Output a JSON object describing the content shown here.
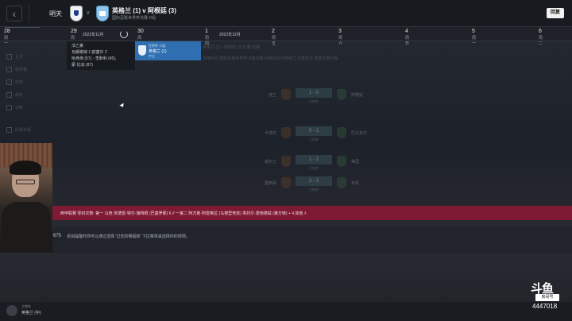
{
  "header": {
    "tomorrow_label": "明天",
    "vs_label": "v",
    "match_title": "英格兰 (1) v 阿根廷 (3)",
    "match_subtitle": "国际足联世界杯决赛 D组",
    "continue_label": "回复"
  },
  "calendar": {
    "month_nov": "2022年11月",
    "month_dec": "2022年12月",
    "days": [
      {
        "num": "28",
        "weekday": "周一"
      },
      {
        "num": "29",
        "weekday": "周二"
      },
      {
        "num": "30",
        "weekday": "周三"
      },
      {
        "num": "1",
        "weekday": "周四"
      },
      {
        "num": "2",
        "weekday": "周五"
      },
      {
        "num": "3",
        "weekday": "周六"
      },
      {
        "num": "4",
        "weekday": "周日"
      },
      {
        "num": "5",
        "weekday": "周一"
      },
      {
        "num": "6",
        "weekday": "周二"
      }
    ]
  },
  "dropdown": {
    "line1": "法乙第",
    "line2": "瓦朗谢纳 1 欧塞尔 2",
    "line3": "哈肯南 (57) - 李默利 (45),",
    "line4": "蒙·比派 (87)"
  },
  "today_card": {
    "line1": "世界杯 小组",
    "line2": "英格兰 (1)",
    "line3": "中立"
  },
  "sidebar": {
    "items": [
      "主页",
      "收件箱",
      "阵容",
      "战术",
      "训练",
      "比赛日程"
    ]
  },
  "background": {
    "line1": "英格兰 (1) - 阿根廷 (3) 比赛 比赛",
    "line2": "当地时间 国际足联世界杯 D组比赛 阿根廷对阵英格兰 比赛信息 其他比赛日程",
    "fixtures": [
      {
        "home": "波兰",
        "score": "1 - 0",
        "status": "已结束",
        "away": "阿根廷"
      },
      {
        "home": "卡塔尔",
        "score": "0 - 1",
        "status": "已结束",
        "away": "厄瓜多尔"
      },
      {
        "home": "威尔士",
        "score": "1 - 1",
        "status": "已结束",
        "away": "美国"
      },
      {
        "home": "墨西哥",
        "score": "2 - 1",
        "status": "已结束",
        "away": "日本"
      }
    ]
  },
  "banner": {
    "text_before": "西甲联赛 零封次数: 第一 马竞·安德雷·特尔·施特根 (巴塞罗那) 6 // 一第二 阿方斯·阿雷奥拉 (马德里竞技) 埃托尔·费南德兹 (莱万特) + 4 其他",
    "highlight": "4"
  },
  "assistant": {
    "number": "675",
    "text": "添加提醒时你可以通过选择 '过去的赛程和' 下拉菜单来选择你的规则。"
  },
  "manager": {
    "role": "主教练",
    "name": "英格兰 (中)"
  },
  "watermark": {
    "logo": "斗鱼",
    "room_label": "房间号",
    "room_number": "4447018"
  }
}
